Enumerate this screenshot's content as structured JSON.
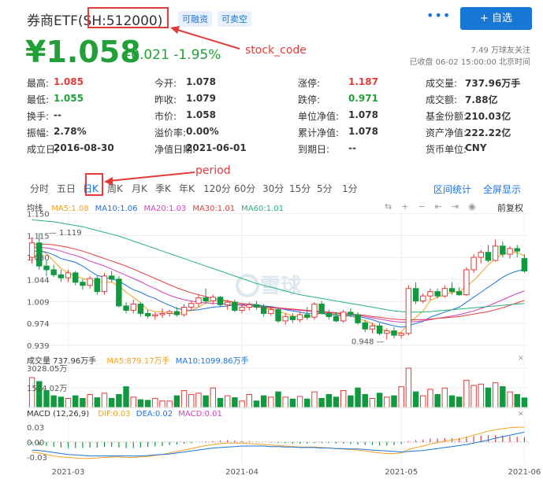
{
  "header": {
    "name": "券商ETF",
    "code_open": "(",
    "code": "SH:512000",
    "code_close": ")",
    "tag1": "可融资",
    "tag2": "可卖空",
    "more": "•••",
    "follow_label": "+ 自选"
  },
  "quote": {
    "price": "¥1.058",
    "change": "-0.021",
    "change_pct": "-1.95%",
    "followers": "7.49 万球友关注",
    "status": "已收盘 06-02 15:00:00 北京时间"
  },
  "annotations": {
    "stock_code": "stock_code",
    "period": "period"
  },
  "stats": [
    [
      {
        "label": "最高:",
        "value": "1.085",
        "color": "red"
      },
      {
        "label": "今开:",
        "value": "1.078",
        "color": "black"
      },
      {
        "label": "涨停:",
        "value": "1.187",
        "color": "red"
      },
      {
        "label": "成交量:",
        "value": "737.96万手",
        "color": "black"
      }
    ],
    [
      {
        "label": "最低:",
        "value": "1.055",
        "color": "green"
      },
      {
        "label": "昨收:",
        "value": "1.079",
        "color": "black"
      },
      {
        "label": "跌停:",
        "value": "0.971",
        "color": "green"
      },
      {
        "label": "成交额:",
        "value": "7.88亿",
        "color": "black"
      }
    ],
    [
      {
        "label": "换手:",
        "value": "--",
        "color": "black"
      },
      {
        "label": "市价:",
        "value": "1.058",
        "color": "black"
      },
      {
        "label": "单位净值:",
        "value": "1.078",
        "color": "black"
      },
      {
        "label": "基金份额:",
        "value": "210.03亿",
        "color": "black"
      }
    ],
    [
      {
        "label": "振幅:",
        "value": "2.78%",
        "color": "black"
      },
      {
        "label": "溢价率:",
        "value": "0.00%",
        "color": "black"
      },
      {
        "label": "累计净值:",
        "value": "1.078",
        "color": "black"
      },
      {
        "label": "资产净值:",
        "value": "222.22亿",
        "color": "black"
      }
    ],
    [
      {
        "label": "成立日:",
        "value": "2016-08-30",
        "color": "black"
      },
      {
        "label": "净值日期:",
        "value": "2021-06-01",
        "color": "black"
      },
      {
        "label": "到期日:",
        "value": "--",
        "color": "black"
      },
      {
        "label": "货币单位:",
        "value": "CNY",
        "color": "black"
      }
    ]
  ],
  "periods": [
    "分时",
    "五日",
    "日K",
    "周K",
    "月K",
    "季K",
    "年K",
    "120分",
    "60分",
    "30分",
    "15分",
    "5分",
    "1分"
  ],
  "active_period": "日K",
  "chart_links": {
    "range_stats": "区间统计",
    "fullscreen": "全屏显示",
    "adjust": "前复权"
  },
  "main_chart": {
    "legend_label": "均线",
    "ma": [
      {
        "name": "MA5:1.08",
        "color": "#f2a11f"
      },
      {
        "name": "MA10:1.06",
        "color": "#1a73d9"
      },
      {
        "name": "MA20:1.03",
        "color": "#d23fbd"
      },
      {
        "name": "MA30:1.01",
        "color": "#e33b3b"
      },
      {
        "name": "MA60:1.01",
        "color": "#26b37a"
      }
    ],
    "y_ticks": [
      "1.150",
      "1.115",
      "1.080",
      "1.044",
      "1.009",
      "0.974",
      "0.939"
    ],
    "high_label": "1.119",
    "low_label": "0.948",
    "watermark": "雪球"
  },
  "volume_chart": {
    "label": "成交量 737.96万手",
    "ma5": "MA5:879.17万手",
    "ma10": "MA10:1099.86万手",
    "y_ticks": [
      "3028.05万",
      "1514.02万"
    ]
  },
  "macd_chart": {
    "label": "MACD (12,26,9)",
    "dif": "DIF:0.03",
    "dea": "DEA:0.02",
    "macd": "MACD:0.01",
    "y_ticks": [
      "0.03",
      "0.00",
      "-0.03"
    ]
  },
  "x_axis": [
    "2021-03",
    "2021-04",
    "2021-05",
    "2021-06"
  ],
  "chart_data": {
    "type": "candlestick",
    "y_range": [
      0.939,
      1.15
    ],
    "candles": [
      {
        "o": 1.08,
        "h": 1.112,
        "l": 1.07,
        "c": 1.103
      },
      {
        "o": 1.103,
        "h": 1.119,
        "l": 1.06,
        "c": 1.066
      },
      {
        "o": 1.066,
        "h": 1.075,
        "l": 1.05,
        "c": 1.06
      },
      {
        "o": 1.06,
        "h": 1.068,
        "l": 1.048,
        "c": 1.052
      },
      {
        "o": 1.052,
        "h": 1.06,
        "l": 1.04,
        "c": 1.047
      },
      {
        "o": 1.047,
        "h": 1.06,
        "l": 1.04,
        "c": 1.055
      },
      {
        "o": 1.055,
        "h": 1.058,
        "l": 1.035,
        "c": 1.04
      },
      {
        "o": 1.04,
        "h": 1.045,
        "l": 1.028,
        "c": 1.035
      },
      {
        "o": 1.035,
        "h": 1.05,
        "l": 1.03,
        "c": 1.046
      },
      {
        "o": 1.046,
        "h": 1.05,
        "l": 1.02,
        "c": 1.025
      },
      {
        "o": 1.025,
        "h": 1.055,
        "l": 1.02,
        "c": 1.05
      },
      {
        "o": 1.05,
        "h": 1.058,
        "l": 1.04,
        "c": 1.045
      },
      {
        "o": 1.045,
        "h": 1.05,
        "l": 1.0,
        "c": 1.002
      },
      {
        "o": 1.002,
        "h": 1.008,
        "l": 0.99,
        "c": 0.995
      },
      {
        "o": 0.995,
        "h": 1.012,
        "l": 0.99,
        "c": 1.005
      },
      {
        "o": 1.005,
        "h": 1.008,
        "l": 0.985,
        "c": 0.99
      },
      {
        "o": 0.99,
        "h": 0.996,
        "l": 0.982,
        "c": 0.986
      },
      {
        "o": 0.986,
        "h": 0.992,
        "l": 0.98,
        "c": 0.988
      },
      {
        "o": 0.988,
        "h": 0.998,
        "l": 0.983,
        "c": 0.99
      },
      {
        "o": 0.99,
        "h": 0.996,
        "l": 0.985,
        "c": 0.993
      },
      {
        "o": 0.993,
        "h": 1.0,
        "l": 0.985,
        "c": 0.988
      },
      {
        "o": 0.988,
        "h": 1.005,
        "l": 0.985,
        "c": 1.0
      },
      {
        "o": 1.0,
        "h": 1.01,
        "l": 0.994,
        "c": 1.006
      },
      {
        "o": 1.006,
        "h": 1.02,
        "l": 1.0,
        "c": 1.015
      },
      {
        "o": 1.015,
        "h": 1.03,
        "l": 1.005,
        "c": 1.01
      },
      {
        "o": 1.01,
        "h": 1.02,
        "l": 1.004,
        "c": 1.016
      },
      {
        "o": 1.016,
        "h": 1.018,
        "l": 1.0,
        "c": 1.004
      },
      {
        "o": 1.004,
        "h": 1.012,
        "l": 0.996,
        "c": 1.008
      },
      {
        "o": 1.008,
        "h": 1.012,
        "l": 0.992,
        "c": 0.995
      },
      {
        "o": 0.995,
        "h": 1.004,
        "l": 0.99,
        "c": 1.0
      },
      {
        "o": 1.0,
        "h": 1.008,
        "l": 0.995,
        "c": 1.004
      },
      {
        "o": 1.004,
        "h": 1.01,
        "l": 0.996,
        "c": 1.0
      },
      {
        "o": 1.0,
        "h": 1.005,
        "l": 0.985,
        "c": 0.99
      },
      {
        "o": 0.99,
        "h": 1.0,
        "l": 0.986,
        "c": 0.996
      },
      {
        "o": 0.996,
        "h": 1.0,
        "l": 0.975,
        "c": 0.978
      },
      {
        "o": 0.978,
        "h": 0.99,
        "l": 0.972,
        "c": 0.985
      },
      {
        "o": 0.985,
        "h": 0.99,
        "l": 0.975,
        "c": 0.98
      },
      {
        "o": 0.98,
        "h": 0.992,
        "l": 0.976,
        "c": 0.988
      },
      {
        "o": 0.988,
        "h": 1.0,
        "l": 0.98,
        "c": 0.984
      },
      {
        "o": 0.984,
        "h": 1.008,
        "l": 0.98,
        "c": 1.005
      },
      {
        "o": 1.005,
        "h": 1.01,
        "l": 0.988,
        "c": 0.99
      },
      {
        "o": 0.99,
        "h": 0.996,
        "l": 0.98,
        "c": 0.985
      },
      {
        "o": 0.985,
        "h": 0.992,
        "l": 0.976,
        "c": 0.978
      },
      {
        "o": 0.978,
        "h": 0.996,
        "l": 0.975,
        "c": 0.992
      },
      {
        "o": 0.992,
        "h": 0.998,
        "l": 0.984,
        "c": 0.988
      },
      {
        "o": 0.988,
        "h": 0.992,
        "l": 0.972,
        "c": 0.975
      },
      {
        "o": 0.975,
        "h": 0.98,
        "l": 0.96,
        "c": 0.965
      },
      {
        "o": 0.965,
        "h": 0.975,
        "l": 0.958,
        "c": 0.97
      },
      {
        "o": 0.97,
        "h": 0.974,
        "l": 0.955,
        "c": 0.958
      },
      {
        "o": 0.958,
        "h": 0.966,
        "l": 0.948,
        "c": 0.962
      },
      {
        "o": 0.962,
        "h": 0.968,
        "l": 0.95,
        "c": 0.955
      },
      {
        "o": 0.955,
        "h": 0.96,
        "l": 0.95,
        "c": 0.958
      },
      {
        "o": 0.958,
        "h": 1.035,
        "l": 0.955,
        "c": 1.03
      },
      {
        "o": 1.03,
        "h": 1.04,
        "l": 1.005,
        "c": 1.01
      },
      {
        "o": 1.01,
        "h": 1.022,
        "l": 1.006,
        "c": 1.018
      },
      {
        "o": 1.018,
        "h": 1.03,
        "l": 1.012,
        "c": 1.025
      },
      {
        "o": 1.025,
        "h": 1.03,
        "l": 1.014,
        "c": 1.018
      },
      {
        "o": 1.018,
        "h": 1.035,
        "l": 1.015,
        "c": 1.03
      },
      {
        "o": 1.03,
        "h": 1.04,
        "l": 1.02,
        "c": 1.025
      },
      {
        "o": 1.025,
        "h": 1.032,
        "l": 1.018,
        "c": 1.02
      },
      {
        "o": 1.02,
        "h": 1.064,
        "l": 1.018,
        "c": 1.06
      },
      {
        "o": 1.06,
        "h": 1.085,
        "l": 1.055,
        "c": 1.08
      },
      {
        "o": 1.08,
        "h": 1.092,
        "l": 1.07,
        "c": 1.088
      },
      {
        "o": 1.088,
        "h": 1.1,
        "l": 1.072,
        "c": 1.075
      },
      {
        "o": 1.075,
        "h": 1.108,
        "l": 1.073,
        "c": 1.098
      },
      {
        "o": 1.098,
        "h": 1.105,
        "l": 1.08,
        "c": 1.085
      },
      {
        "o": 1.085,
        "h": 1.098,
        "l": 1.078,
        "c": 1.094
      },
      {
        "o": 1.094,
        "h": 1.1,
        "l": 1.08,
        "c": 1.09
      },
      {
        "o": 1.078,
        "h": 1.085,
        "l": 1.055,
        "c": 1.058
      }
    ],
    "ma_series": {
      "ma5": [
        1.098,
        1.094,
        1.086,
        1.074,
        1.062,
        1.055,
        1.05,
        1.046,
        1.044,
        1.04,
        1.04,
        1.04,
        1.034,
        1.024,
        1.016,
        1.007,
        0.996,
        0.993,
        0.993,
        0.99,
        0.989,
        0.992,
        0.995,
        1.0,
        1.007,
        1.011,
        1.01,
        1.01,
        1.006,
        1.004,
        1.001,
        1.001,
        0.998,
        0.998,
        0.993,
        0.99,
        0.986,
        0.985,
        0.983,
        0.988,
        0.99,
        0.99,
        0.988,
        0.988,
        0.986,
        0.982,
        0.978,
        0.974,
        0.966,
        0.962,
        0.958,
        0.96,
        0.974,
        0.984,
        0.994,
        1.011,
        1.016,
        1.02,
        1.024,
        1.025,
        1.033,
        1.043,
        1.055,
        1.068,
        1.078,
        1.085,
        1.088,
        1.088,
        1.082
      ],
      "ma10": [
        1.09,
        1.09,
        1.088,
        1.084,
        1.078,
        1.075,
        1.072,
        1.066,
        1.058,
        1.051,
        1.048,
        1.045,
        1.042,
        1.035,
        1.028,
        1.024,
        1.018,
        1.014,
        1.008,
        1.003,
        0.998,
        0.996,
        0.995,
        0.996,
        0.998,
        1.0,
        1.001,
        1.002,
        1.003,
        1.004,
        1.005,
        1.004,
        1.002,
        1.001,
        0.999,
        0.996,
        0.994,
        0.992,
        0.99,
        0.99,
        0.99,
        0.988,
        0.987,
        0.986,
        0.986,
        0.985,
        0.983,
        0.98,
        0.976,
        0.973,
        0.97,
        0.968,
        0.97,
        0.974,
        0.977,
        0.984,
        0.988,
        0.992,
        0.996,
        1.0,
        1.008,
        1.016,
        1.024,
        1.032,
        1.04,
        1.048,
        1.054,
        1.058,
        1.06
      ],
      "ma20": [
        1.095,
        1.096,
        1.095,
        1.093,
        1.09,
        1.086,
        1.083,
        1.079,
        1.074,
        1.07,
        1.066,
        1.061,
        1.056,
        1.051,
        1.046,
        1.041,
        1.035,
        1.03,
        1.024,
        1.019,
        1.015,
        1.012,
        1.01,
        1.008,
        1.007,
        1.006,
        1.006,
        1.005,
        1.004,
        1.003,
        1.002,
        1.001,
        1.0,
        0.999,
        0.998,
        0.997,
        0.996,
        0.995,
        0.994,
        0.993,
        0.992,
        0.991,
        0.99,
        0.989,
        0.988,
        0.987,
        0.985,
        0.983,
        0.981,
        0.979,
        0.977,
        0.976,
        0.976,
        0.977,
        0.978,
        0.98,
        0.982,
        0.984,
        0.986,
        0.988,
        0.991,
        0.994,
        0.998,
        1.002,
        1.007,
        1.012,
        1.017,
        1.022,
        1.026
      ],
      "ma30": [
        1.1,
        1.101,
        1.101,
        1.1,
        1.098,
        1.096,
        1.093,
        1.09,
        1.086,
        1.082,
        1.078,
        1.074,
        1.07,
        1.066,
        1.061,
        1.056,
        1.051,
        1.046,
        1.041,
        1.036,
        1.031,
        1.027,
        1.023,
        1.02,
        1.017,
        1.014,
        1.012,
        1.01,
        1.008,
        1.006,
        1.004,
        1.002,
        1.001,
        1.0,
        0.999,
        0.998,
        0.997,
        0.996,
        0.995,
        0.994,
        0.993,
        0.992,
        0.991,
        0.99,
        0.989,
        0.988,
        0.987,
        0.985,
        0.984,
        0.982,
        0.981,
        0.98,
        0.98,
        0.98,
        0.98,
        0.981,
        0.982,
        0.983,
        0.984,
        0.985,
        0.987,
        0.989,
        0.991,
        0.993,
        0.996,
        0.999,
        1.003,
        1.007,
        1.011
      ],
      "ma60": [
        1.14,
        1.139,
        1.138,
        1.137,
        1.135,
        1.133,
        1.131,
        1.129,
        1.126,
        1.123,
        1.12,
        1.117,
        1.114,
        1.11,
        1.106,
        1.102,
        1.098,
        1.094,
        1.09,
        1.086,
        1.082,
        1.078,
        1.074,
        1.07,
        1.066,
        1.062,
        1.058,
        1.054,
        1.05,
        1.046,
        1.042,
        1.038,
        1.035,
        1.032,
        1.029,
        1.026,
        1.023,
        1.02,
        1.018,
        1.016,
        1.014,
        1.012,
        1.01,
        1.008,
        1.006,
        1.004,
        1.002,
        1.0,
        0.998,
        0.996,
        0.994,
        0.993,
        0.992,
        0.992,
        0.992,
        0.993,
        0.994,
        0.995,
        0.996,
        0.997,
        0.998,
        0.999,
        1.0,
        1.001,
        1.002,
        1.003,
        1.004,
        1.005,
        1.006
      ]
    },
    "volume": [
      2300,
      2000,
      1300,
      900,
      800,
      700,
      900,
      700,
      1000,
      750,
      1100,
      700,
      1000,
      1600,
      800,
      600,
      550,
      700,
      500,
      500,
      900,
      1300,
      1000,
      1100,
      900,
      1500,
      700,
      900,
      750,
      500,
      1000,
      500,
      900,
      800,
      1200,
      800,
      650,
      850,
      650,
      1200,
      700,
      1000,
      800,
      1300,
      900,
      1500,
      1000,
      700,
      1100,
      800,
      900,
      1600,
      3028,
      1200,
      900,
      1400,
      1000,
      1500,
      900,
      800,
      2100,
      1700,
      1800,
      1500,
      1900,
      1600,
      1200,
      1000,
      738
    ],
    "macd_hist": [
      -0.004,
      -0.006,
      -0.008,
      -0.01,
      -0.011,
      -0.012,
      -0.012,
      -0.012,
      -0.011,
      -0.011,
      -0.01,
      -0.01,
      -0.011,
      -0.012,
      -0.012,
      -0.011,
      -0.01,
      -0.009,
      -0.008,
      -0.006,
      -0.005,
      -0.003,
      -0.002,
      0.0,
      0.001,
      0.002,
      0.003,
      0.004,
      0.003,
      0.002,
      0.002,
      0.001,
      0.0,
      -0.001,
      -0.002,
      -0.002,
      -0.003,
      -0.003,
      -0.003,
      -0.002,
      -0.002,
      -0.002,
      -0.003,
      -0.003,
      -0.004,
      -0.005,
      -0.006,
      -0.006,
      -0.007,
      -0.007,
      -0.006,
      -0.004,
      0.002,
      0.004,
      0.005,
      0.007,
      0.007,
      0.008,
      0.008,
      0.008,
      0.01,
      0.012,
      0.013,
      0.014,
      0.014,
      0.013,
      0.012,
      0.011,
      0.01
    ],
    "dif": [
      -0.02,
      -0.022,
      -0.025,
      -0.028,
      -0.03,
      -0.031,
      -0.032,
      -0.033,
      -0.033,
      -0.032,
      -0.031,
      -0.03,
      -0.03,
      -0.031,
      -0.031,
      -0.03,
      -0.029,
      -0.027,
      -0.025,
      -0.022,
      -0.019,
      -0.016,
      -0.013,
      -0.01,
      -0.007,
      -0.005,
      -0.003,
      -0.002,
      -0.002,
      -0.002,
      -0.003,
      -0.004,
      -0.005,
      -0.006,
      -0.007,
      -0.008,
      -0.009,
      -0.01,
      -0.01,
      -0.01,
      -0.011,
      -0.012,
      -0.013,
      -0.014,
      -0.015,
      -0.016,
      -0.018,
      -0.02,
      -0.022,
      -0.023,
      -0.023,
      -0.022,
      -0.015,
      -0.011,
      -0.008,
      -0.004,
      -0.001,
      0.002,
      0.004,
      0.006,
      0.01,
      0.014,
      0.018,
      0.022,
      0.025,
      0.027,
      0.029,
      0.03,
      0.03
    ],
    "dea": [
      -0.016,
      -0.017,
      -0.019,
      -0.021,
      -0.023,
      -0.025,
      -0.026,
      -0.027,
      -0.028,
      -0.028,
      -0.028,
      -0.028,
      -0.028,
      -0.028,
      -0.028,
      -0.028,
      -0.027,
      -0.026,
      -0.025,
      -0.024,
      -0.022,
      -0.02,
      -0.018,
      -0.016,
      -0.014,
      -0.012,
      -0.011,
      -0.01,
      -0.009,
      -0.008,
      -0.008,
      -0.008,
      -0.008,
      -0.009,
      -0.009,
      -0.01,
      -0.01,
      -0.011,
      -0.011,
      -0.011,
      -0.012,
      -0.012,
      -0.013,
      -0.013,
      -0.014,
      -0.014,
      -0.015,
      -0.016,
      -0.017,
      -0.018,
      -0.019,
      -0.02,
      -0.019,
      -0.018,
      -0.017,
      -0.015,
      -0.013,
      -0.011,
      -0.009,
      -0.007,
      -0.005,
      -0.002,
      0.001,
      0.004,
      0.008,
      0.011,
      0.014,
      0.017,
      0.02
    ]
  }
}
